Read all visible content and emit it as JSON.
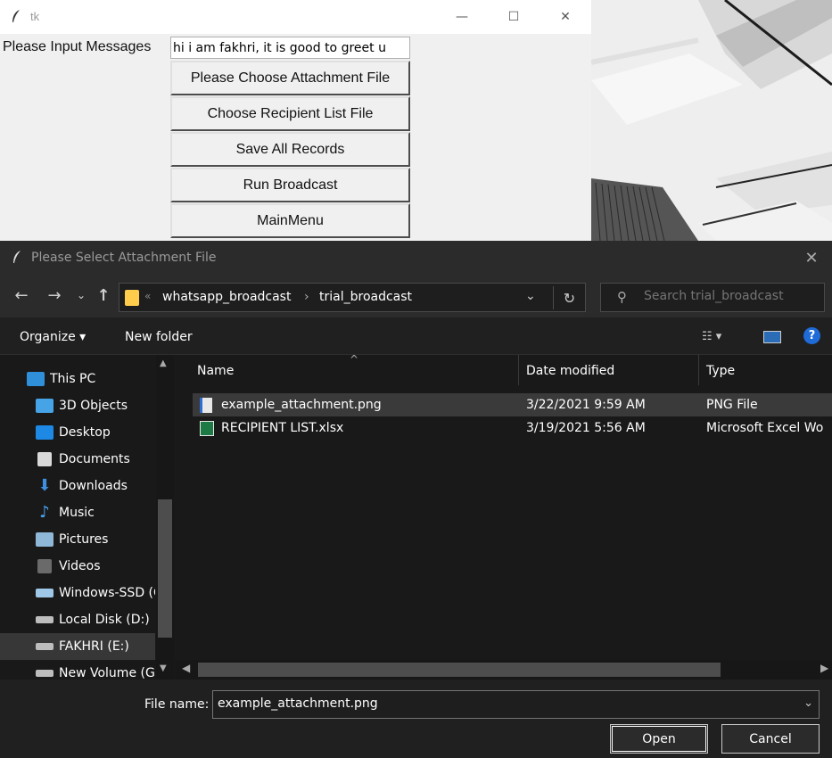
{
  "tk_window": {
    "title": "tk",
    "message_label": "Please Input Messages",
    "message_value": "hi i am fakhri, it is good to greet u",
    "buttons": [
      "Please Choose Attachment File",
      "Choose Recipient List File",
      "Save All Records",
      "Run Broadcast",
      "MainMenu"
    ],
    "controls": {
      "minimize": "—",
      "maximize": "☐",
      "close": "✕"
    }
  },
  "dialog": {
    "title": "Please Select Attachment File",
    "close": "✕",
    "nav": {
      "back": "←",
      "forward": "→",
      "recent": "⌄",
      "up": "↑"
    },
    "breadcrumb": [
      "whatsapp_broadcast",
      "trial_broadcast"
    ],
    "search_placeholder": "Search trial_broadcast",
    "toolbar": {
      "organize": "Organize ▾",
      "new_folder": "New folder",
      "help": "?"
    },
    "sidebar": [
      {
        "label": "This PC",
        "icon": "pc-icon",
        "color": "#2f8fd8",
        "selected": false
      },
      {
        "label": "3D Objects",
        "icon": "cube-icon",
        "color": "#45a3e6",
        "selected": false
      },
      {
        "label": "Desktop",
        "icon": "desktop-icon",
        "color": "#1e88e5",
        "selected": false
      },
      {
        "label": "Documents",
        "icon": "documents-icon",
        "color": "#d9d9d9",
        "selected": false
      },
      {
        "label": "Downloads",
        "icon": "downloads-icon",
        "color": "#3d8fe0",
        "selected": false
      },
      {
        "label": "Music",
        "icon": "music-icon",
        "color": "#4aa3f0",
        "selected": false
      },
      {
        "label": "Pictures",
        "icon": "pictures-icon",
        "color": "#8fb8d8",
        "selected": false
      },
      {
        "label": "Videos",
        "icon": "videos-icon",
        "color": "#6a6a6a",
        "selected": false
      },
      {
        "label": "Windows-SSD (C",
        "icon": "drive-windows-icon",
        "color": "#9fc7e8",
        "selected": false
      },
      {
        "label": "Local Disk (D:)",
        "icon": "drive-icon",
        "color": "#bdbdbd",
        "selected": false
      },
      {
        "label": "FAKHRI (E:)",
        "icon": "usb-drive-icon",
        "color": "#bdbdbd",
        "selected": true
      },
      {
        "label": "New Volume (G:",
        "icon": "drive-icon",
        "color": "#bdbdbd",
        "selected": false
      }
    ],
    "columns": [
      "Name",
      "Date modified",
      "Type"
    ],
    "files": [
      {
        "name": "example_attachment.png",
        "date": "3/22/2021 9:59 AM",
        "type": "PNG File",
        "icon": "png-file-icon",
        "selected": true
      },
      {
        "name": "RECIPIENT LIST.xlsx",
        "date": "3/19/2021 5:56 AM",
        "type": "Microsoft Excel Wo",
        "icon": "excel-file-icon",
        "selected": false
      }
    ],
    "file_name_label": "File name:",
    "file_name_value": "example_attachment.png",
    "open_label": "Open",
    "cancel_label": "Cancel"
  }
}
